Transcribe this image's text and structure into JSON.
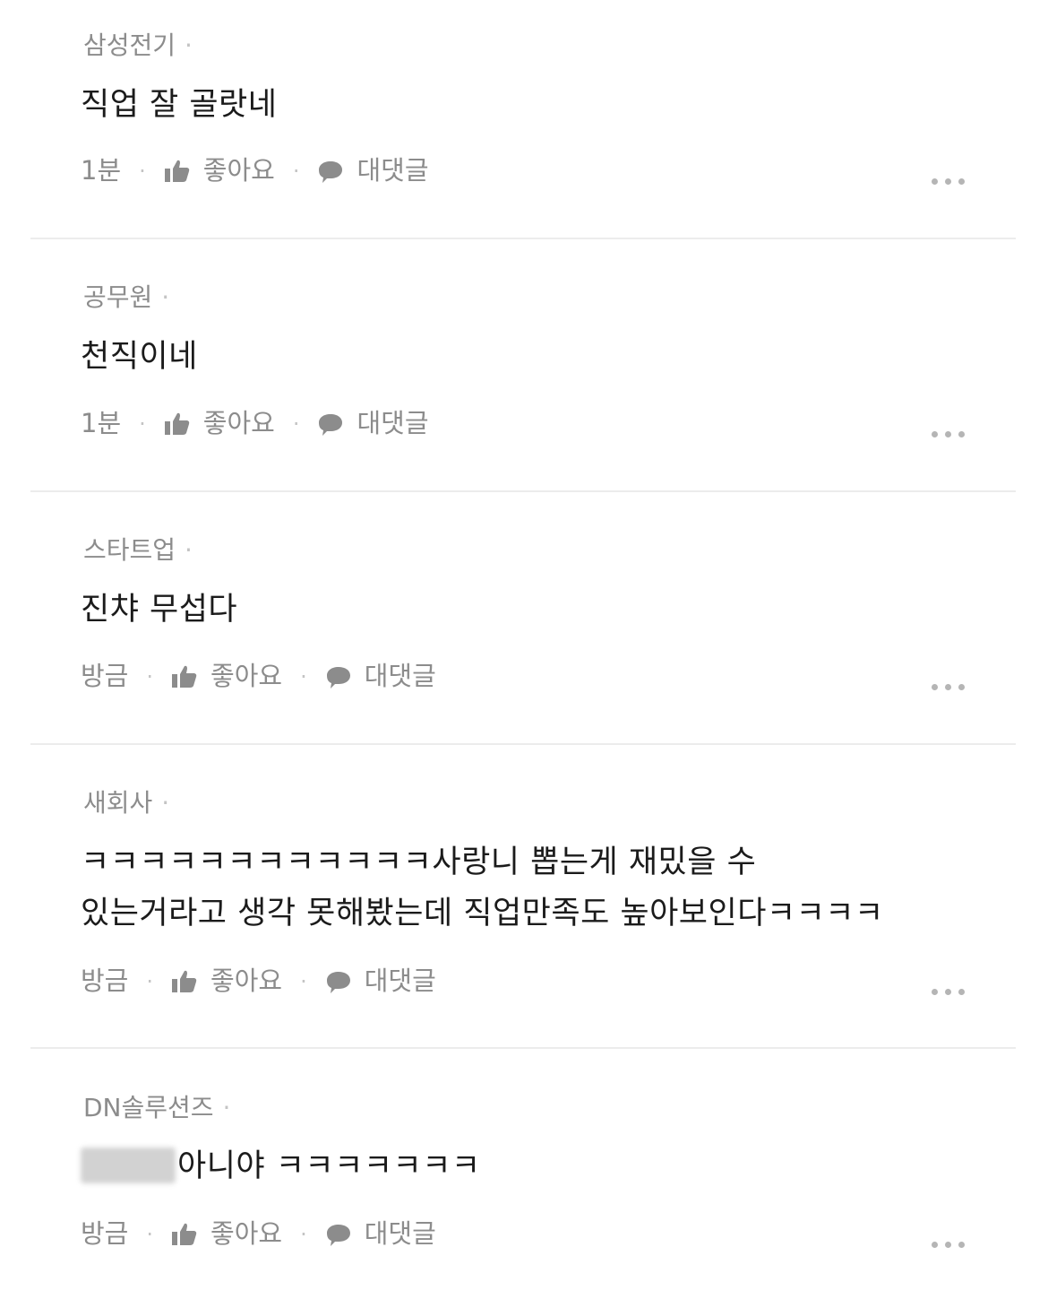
{
  "comments": [
    {
      "author": "삼성전기",
      "author_sep": "·",
      "lines": [
        "직업 잘 골랏네"
      ],
      "time": "1분",
      "like_label": "좋아요",
      "reply_label": "대댓글",
      "like_icon": "thumbs-up-icon",
      "reply_icon": "speech-bubble-icon",
      "more_icon": "more-icon"
    },
    {
      "author": "공무원",
      "author_sep": "·",
      "lines": [
        "천직이네"
      ],
      "time": "1분",
      "like_label": "좋아요",
      "reply_label": "대댓글",
      "like_icon": "thumbs-up-icon",
      "reply_icon": "speech-bubble-icon",
      "more_icon": "more-icon"
    },
    {
      "author": "스타트업",
      "author_sep": "·",
      "lines": [
        "진챠 무섭다"
      ],
      "time": "방금",
      "like_label": "좋아요",
      "reply_label": "대댓글",
      "like_icon": "thumbs-up-icon",
      "reply_icon": "speech-bubble-icon",
      "more_icon": "more-icon"
    },
    {
      "author": "새회사",
      "author_sep": "·",
      "lines": [
        "ㅋㅋㅋㅋㅋㅋㅋㅋㅋㅋㅋㅋ사랑니 뽑는게 재밌을 수",
        "있는거라고 생각 못해봤는데 직업만족도 높아보인다ㅋㅋㅋㅋ"
      ],
      "time": "방금",
      "like_label": "좋아요",
      "reply_label": "대댓글",
      "like_icon": "thumbs-up-icon",
      "reply_icon": "speech-bubble-icon",
      "more_icon": "more-icon"
    },
    {
      "author": "DN솔루션즈",
      "author_sep": "·",
      "lines": [
        "아니야 ㅋㅋㅋㅋㅋㅋㅋ"
      ],
      "time": "방금",
      "like_label": "좋아요",
      "reply_label": "대댓글",
      "like_icon": "thumbs-up-icon",
      "reply_icon": "speech-bubble-icon",
      "more_icon": "more-icon"
    }
  ],
  "colors": {
    "author": "#8c8c8c",
    "body": "#1b1b1b",
    "meta": "#8c8c8c",
    "divider": "#ececec"
  }
}
